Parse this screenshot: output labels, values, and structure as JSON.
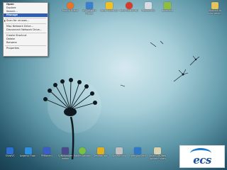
{
  "context_menu": {
    "items": [
      {
        "label": "Open",
        "style": "bold"
      },
      {
        "label": "Explore",
        "style": "normal"
      },
      {
        "label": "Search...",
        "style": "normal"
      },
      {
        "label": "Manage",
        "style": "highlighted"
      },
      {
        "label": "Scan for viruses...",
        "style": "shield"
      },
      {
        "label": "Map Network Drive...",
        "style": "normal"
      },
      {
        "label": "Disconnect Network Drive...",
        "style": "normal"
      },
      {
        "label": "Create Shortcut",
        "style": "normal"
      },
      {
        "label": "Delete",
        "style": "normal"
      },
      {
        "label": "Rename",
        "style": "normal"
      },
      {
        "label": "Properties",
        "style": "normal"
      }
    ]
  },
  "top_icons": [
    {
      "label": "Mozilla Firefox",
      "icon": "firefox-icon",
      "color": "#e8742a"
    },
    {
      "label": "My Network Places",
      "icon": "network-icon",
      "color": "#3c7fd0"
    },
    {
      "label": "Lotus Notes 6.5",
      "icon": "lotus-notes-icon",
      "color": "#f3c21b"
    },
    {
      "label": "Nero StartSmart",
      "icon": "nero-icon",
      "color": "#d93a2b"
    },
    {
      "label": "Recycle Bin",
      "icon": "recycle-bin-icon",
      "color": "#d6dce2"
    },
    {
      "label": "qmap.exe",
      "icon": "qmap-icon",
      "color": "#8fbf3a"
    },
    {
      "label": "Shortcut to Informatio...",
      "icon": "folder-shortcut-icon",
      "color": "#e6c45c"
    }
  ],
  "bottom_icons": [
    {
      "label": "ShowVS",
      "icon": "showvs-icon",
      "color": "#2d6fd0"
    },
    {
      "label": "Avigenix Flow...",
      "icon": "avigenix-icon",
      "color": "#2f8fe0"
    },
    {
      "label": "PEMsheny",
      "icon": "pemsheny-icon",
      "color": "#3b5dc8"
    },
    {
      "label": "SyNManager mafon",
      "icon": "synmanager-icon",
      "color": "#4a4a8a"
    },
    {
      "label": "Babies Advisor",
      "icon": "babies-advisor-icon",
      "color": "#7ac142"
    },
    {
      "label": "Desktop tool",
      "icon": "desktop-tool-icon",
      "color": "#e0b020"
    },
    {
      "label": "AntiHashing",
      "icon": "antihashing-icon",
      "color": "#c0c0c0"
    },
    {
      "label": "ExtensionShell",
      "icon": "extensionshell-icon",
      "color": "#2f78c8"
    },
    {
      "label": "Ubuntu-to-Web Upload Folder",
      "icon": "upload-folder-icon",
      "color": "#d9d2b0"
    }
  ],
  "logo": {
    "text": "ecs"
  }
}
